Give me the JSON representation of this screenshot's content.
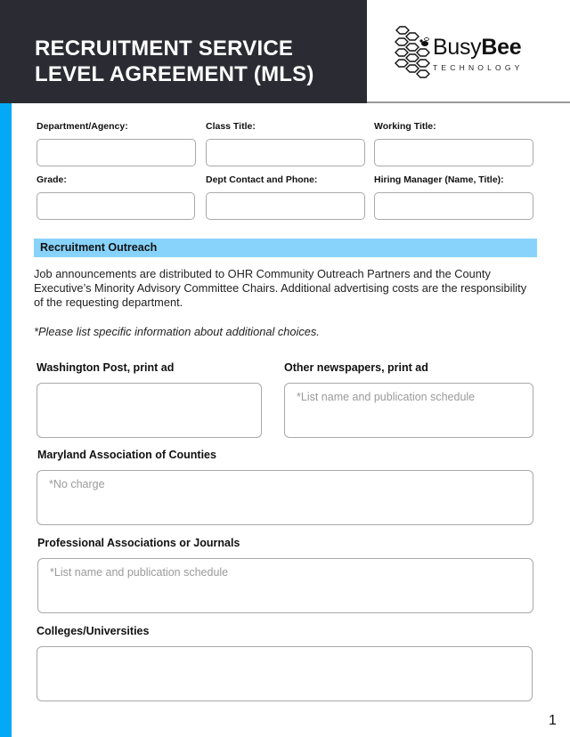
{
  "header": {
    "title_line1": "RECRUITMENT SERVICE",
    "title_line2": "LEVEL AGREEMENT (MLS)",
    "dark_color": "#2b2b33",
    "accent_color": "#03a9f4"
  },
  "logo": {
    "name_regular": "Busy",
    "name_bold": "Bee",
    "subtitle": "TECHNOLOGY",
    "icon": "honeycomb-bee-icon"
  },
  "info_fields": [
    {
      "label": "Department/Agency:",
      "value": ""
    },
    {
      "label": "Class Title:",
      "value": ""
    },
    {
      "label": "Working Title:",
      "value": ""
    },
    {
      "label": "Grade:",
      "value": ""
    },
    {
      "label": "Dept Contact and Phone:",
      "value": ""
    },
    {
      "label": "Hiring Manager (Name, Title):",
      "value": ""
    }
  ],
  "section": {
    "title": "Recruitment Outreach",
    "color": "#88d3fb",
    "paragraph": "Job announcements are distributed to OHR Community Outreach Partners and the County Executive’s Minority Advisory Committee Chairs.  Additional advertising costs are the responsibility of the requesting department.",
    "note": "*Please list specific information about additional choices."
  },
  "outreach_fields": [
    {
      "label": "Washington Post, print ad",
      "placeholder": ""
    },
    {
      "label": "Other newspapers, print ad",
      "placeholder": "*List name and publication schedule"
    },
    {
      "label": "Maryland Association of Counties",
      "placeholder": "*No charge"
    },
    {
      "label": "Professional Associations or Journals",
      "placeholder": "*List name and publication schedule"
    },
    {
      "label": "Colleges/Universities",
      "placeholder": ""
    }
  ],
  "page_number": "1"
}
